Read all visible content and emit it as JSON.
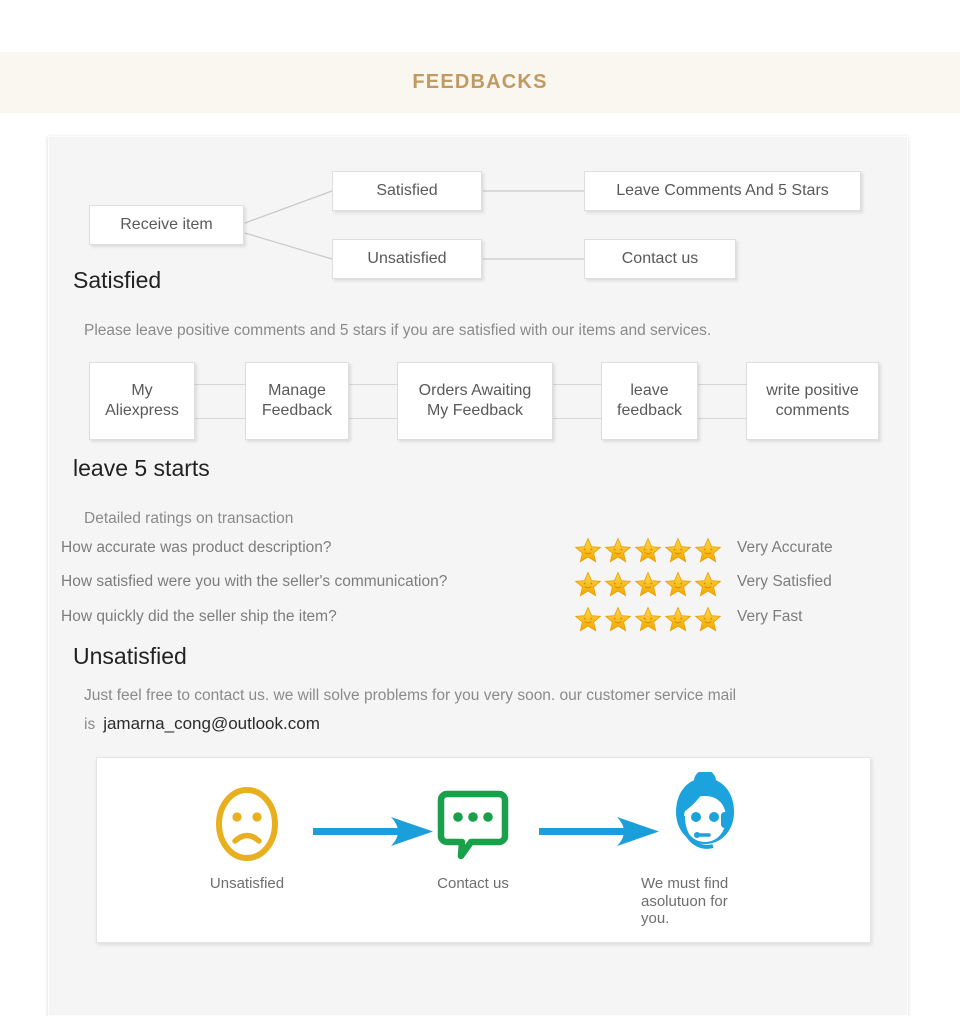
{
  "header": {
    "title": "FEEDBACKS",
    "accent_color": "#c09a63",
    "band_color": "#faf6f0"
  },
  "decision_flow": {
    "root": "Receive item",
    "branches": [
      {
        "condition": "Satisfied",
        "action": "Leave Comments And 5 Stars"
      },
      {
        "condition": "Unsatisfied",
        "action": "Contact us"
      }
    ]
  },
  "satisfied": {
    "heading": "Satisfied",
    "paragraph": "Please leave positive comments and 5 stars if you are satisfied with our items and services.",
    "steps": [
      "My\nAliexpress",
      "Manage\nFeedback",
      "Orders Awaiting\nMy Feedback",
      "leave\nfeedback",
      "write positive\ncomments"
    ]
  },
  "ratings": {
    "heading": "leave 5 starts",
    "subtitle": "Detailed ratings on transaction",
    "star_count": 5,
    "star_color": "#f5c518",
    "rows": [
      {
        "question": "How accurate was product description?",
        "stars": 5,
        "label": "Very Accurate"
      },
      {
        "question": "How satisfied were you with the seller's communication?",
        "stars": 5,
        "label": "Very Satisfied"
      },
      {
        "question": "How quickly did the seller ship the item?",
        "stars": 5,
        "label": "Very Fast"
      }
    ]
  },
  "unsatisfied": {
    "heading": "Unsatisfied",
    "paragraph": "Just feel free to contact us. we will solve problems for you very soon. our customer service mail is",
    "email": "jamarna_cong@outlook.com"
  },
  "illustration": {
    "items": [
      {
        "icon": "sad-face-icon",
        "caption": "Unsatisfied",
        "color": "#e8af1e"
      },
      {
        "icon": "chat-bubble-icon",
        "caption": "Contact us",
        "color": "#18a04a"
      },
      {
        "icon": "support-agent-icon",
        "caption": "We must find\nasolutuon for\nyou.",
        "color": "#1ca2dc"
      }
    ],
    "arrow_color": "#1b9fdb"
  }
}
